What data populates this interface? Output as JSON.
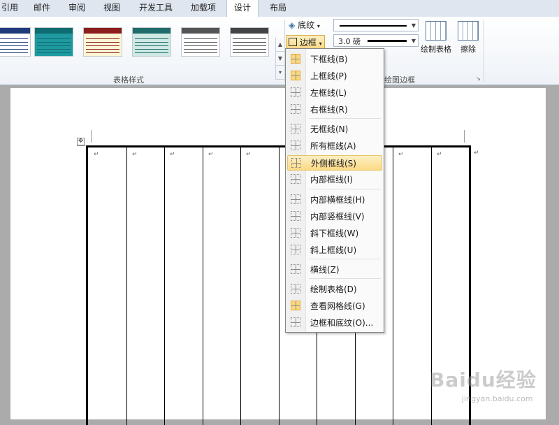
{
  "tabs": [
    "引用",
    "邮件",
    "审阅",
    "视图",
    "开发工具",
    "加载项",
    "设计",
    "布局"
  ],
  "active_tab": "设计",
  "ribbon": {
    "table_styles_label": "表格样式",
    "draw_borders_label": "绘图边框",
    "shading_label": "底纹",
    "borders_label": "边框",
    "line_weight": "3.0 磅",
    "draw_table_label": "绘制表格",
    "eraser_label": "擦除"
  },
  "style_swatches": [
    {
      "header": "#ffffff",
      "body": "#ffffff",
      "accent": "#1f3b7a"
    },
    {
      "header": "#0f6d72",
      "body": "#1e9aa0",
      "accent": "#0f6d72"
    },
    {
      "header": "#8c1d1d",
      "body": "#fbf6d6",
      "accent": "#8c1d1d"
    },
    {
      "header": "#1f6c6a",
      "body": "#cfe9e4",
      "accent": "#1f6c6a"
    },
    {
      "header": "#ffffff",
      "body": "#ffffff",
      "accent": "#555555"
    },
    {
      "header": "#ffffff",
      "body": "#ffffff",
      "accent": "#444444"
    }
  ],
  "borders_menu": [
    {
      "label": "下框线(B)",
      "icon": "bottom-border-icon",
      "checked": true
    },
    {
      "label": "上框线(P)",
      "icon": "top-border-icon",
      "checked": true
    },
    {
      "label": "左框线(L)",
      "icon": "left-border-icon"
    },
    {
      "label": "右框线(R)",
      "icon": "right-border-icon"
    },
    {
      "label": "无框线(N)",
      "icon": "no-border-icon"
    },
    {
      "label": "所有框线(A)",
      "icon": "all-borders-icon"
    },
    {
      "label": "外侧框线(S)",
      "icon": "outside-borders-icon",
      "highlighted": true
    },
    {
      "label": "内部框线(I)",
      "icon": "inside-borders-icon"
    },
    {
      "label": "内部横框线(H)",
      "icon": "inside-horizontal-border-icon"
    },
    {
      "label": "内部竖框线(V)",
      "icon": "inside-vertical-border-icon"
    },
    {
      "label": "斜下框线(W)",
      "icon": "diagonal-down-border-icon"
    },
    {
      "label": "斜上框线(U)",
      "icon": "diagonal-up-border-icon"
    },
    {
      "label": "横线(Z)",
      "icon": "horizontal-line-icon"
    },
    {
      "label": "绘制表格(D)",
      "icon": "draw-table-icon"
    },
    {
      "label": "查看网格线(G)",
      "icon": "view-gridlines-icon",
      "checked": true
    },
    {
      "label": "边框和底纹(O)...",
      "icon": "borders-shading-icon"
    }
  ],
  "colors": {
    "ribbon_tab_bg": "#dfe6f0",
    "highlight": "#fbda85",
    "table_border": "#000000"
  },
  "table": {
    "cell_mark": "↵",
    "columns": 10
  },
  "watermark": {
    "logo": "Baidu经验",
    "url": "jingyan.baidu.com"
  }
}
